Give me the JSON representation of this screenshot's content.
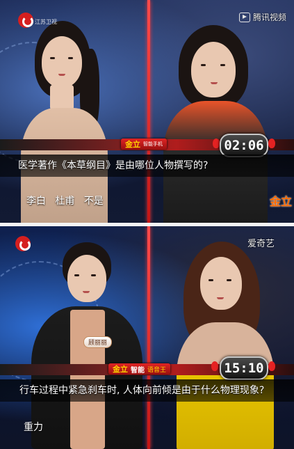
{
  "top": {
    "station_logo_sub": "江苏卫视",
    "watermark_text": "腾讯视频",
    "sponsor_text": "金立",
    "sponsor_sub": "智能手机",
    "timer": "02:06",
    "question": "医学著作《本草纲目》是由哪位人物撰写的?",
    "answer": "李白   杜甫   不是",
    "stage_logo": "金立"
  },
  "bottom": {
    "watermark_text": "爱奇艺",
    "name_tag": "顾丽丽",
    "sponsor_text": "金立",
    "sponsor_extra": "智能",
    "sponsor_label": "语音王",
    "timer": "15:10",
    "question": "行车过程中紧急刹车时, 人体向前倾是由于什么物理现象?",
    "answer": "重力"
  },
  "colors": {
    "accent_red": "#d51f1f",
    "sponsor_yellow": "#ffd400"
  }
}
